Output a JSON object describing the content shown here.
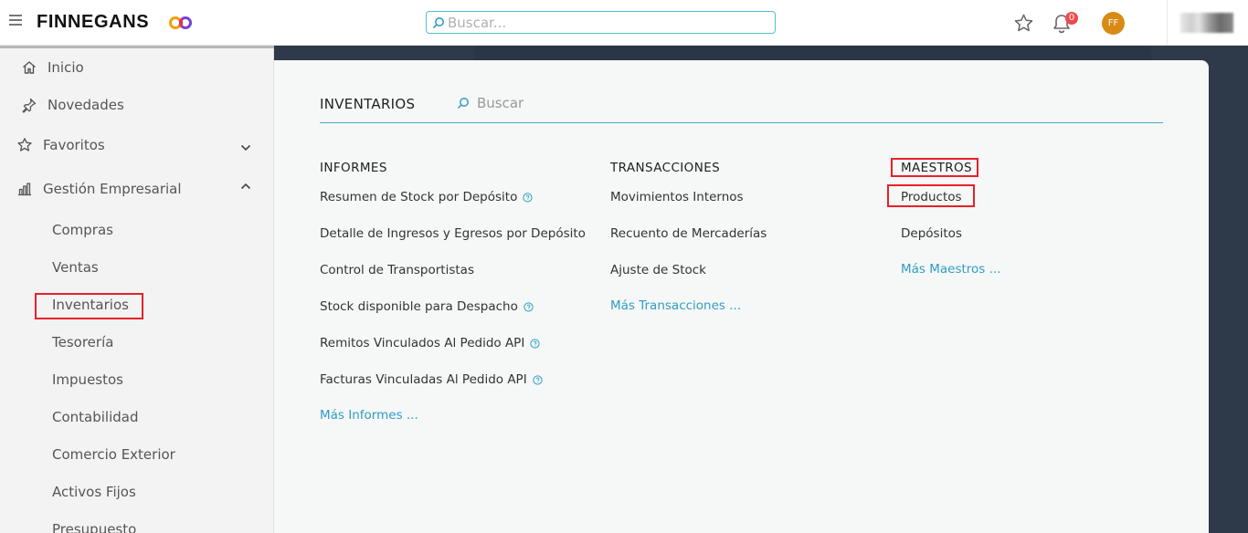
{
  "header": {
    "logo_text": "FINNEGANS",
    "search_placeholder": "Buscar...",
    "notification_count": "0",
    "avatar_initials": "FF"
  },
  "sidebar": {
    "items": [
      {
        "label": "Inicio",
        "icon": "home-icon"
      },
      {
        "label": "Novedades",
        "icon": "pin-icon"
      },
      {
        "label": "Favoritos",
        "icon": "star-icon"
      },
      {
        "label": "Gestión Empresarial",
        "icon": "bar-chart-icon"
      }
    ],
    "subitems": [
      "Compras",
      "Ventas",
      "Inventarios",
      "Tesorería",
      "Impuestos",
      "Contabilidad",
      "Comercio Exterior",
      "Activos Fijos",
      "Presupuesto"
    ]
  },
  "panel": {
    "title": "INVENTARIOS",
    "search_placeholder": "Buscar",
    "columns": {
      "informes": {
        "heading": "INFORMES",
        "items": [
          "Resumen de Stock por Depósito",
          "Detalle de Ingresos y Egresos por Depósito",
          "Control de Transportistas",
          "Stock disponible para Despacho",
          "Remitos Vinculados Al Pedido API",
          "Facturas Vinculadas Al Pedido API"
        ],
        "more": "Más Informes ..."
      },
      "transacciones": {
        "heading": "TRANSACCIONES",
        "items": [
          "Movimientos Internos",
          "Recuento de Mercaderías",
          "Ajuste de Stock"
        ],
        "more": "Más Transacciones ..."
      },
      "maestros": {
        "heading": "MAESTROS",
        "items": [
          "Productos",
          "Depósitos"
        ],
        "more": "Más Maestros ..."
      }
    }
  },
  "colors": {
    "accent": "#2f9ec4",
    "highlight": "#e8202a",
    "avatar": "#d98a14",
    "badge": "#f04b4b"
  }
}
